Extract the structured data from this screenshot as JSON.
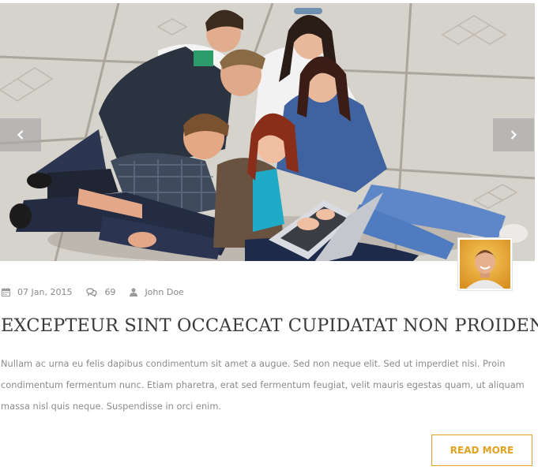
{
  "post": {
    "date": "07 Jan, 2015",
    "comments": "69",
    "author": "John Doe",
    "title": "EXCEPTEUR SINT OCCAECAT CUPIDATAT NON PROIDENT",
    "excerpt": "Nullam ac urna eu felis dapibus condimentum sit amet a augue. Sed non neque elit. Sed ut imperdiet nisi. Proin condimentum fermentum nunc. Etiam pharetra, erat sed fermentum feugiat, velit mauris egestas quam, ut aliquam massa nisl quis neque. Suspendisse in orci enim.",
    "read_more_label": "READ MORE"
  },
  "icons": {
    "date": "calendar-icon",
    "comments": "comments-icon",
    "author": "user-icon",
    "prev": "chevron-left-icon",
    "next": "chevron-right-icon"
  },
  "colors": {
    "accent": "#e0a321",
    "title": "#3a3a3a",
    "text": "#8c8c8c",
    "meta": "#8a8a8a"
  }
}
